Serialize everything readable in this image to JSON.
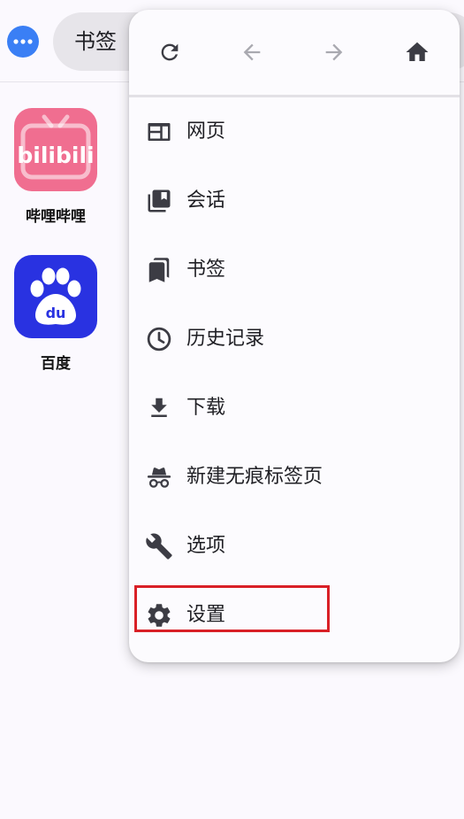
{
  "header": {
    "search_text": "书签"
  },
  "shortcuts": [
    {
      "label": "哔哩哔哩",
      "icon": "bilibili-logo-icon",
      "color": "#f06e90"
    },
    {
      "label": "百度",
      "icon": "baidu-paw-icon",
      "color": "#2932e1"
    }
  ],
  "menu": {
    "nav": [
      {
        "name": "reload",
        "icon": "reload-icon",
        "enabled": true
      },
      {
        "name": "back",
        "icon": "arrow-left-icon",
        "enabled": false
      },
      {
        "name": "forward",
        "icon": "arrow-right-icon",
        "enabled": false
      },
      {
        "name": "home",
        "icon": "home-icon",
        "enabled": true
      }
    ],
    "items": [
      {
        "label": "网页",
        "icon": "webpage-icon"
      },
      {
        "label": "会话",
        "icon": "sessions-icon"
      },
      {
        "label": "书签",
        "icon": "bookmarks-icon"
      },
      {
        "label": "历史记录",
        "icon": "history-clock-icon"
      },
      {
        "label": "下载",
        "icon": "download-icon"
      },
      {
        "label": "新建无痕标签页",
        "icon": "incognito-icon"
      },
      {
        "label": "选项",
        "icon": "wrench-icon"
      },
      {
        "label": "设置",
        "icon": "gear-icon"
      }
    ],
    "highlighted_item": "设置"
  },
  "colors": {
    "accent": "#3a7ff5",
    "highlight": "#d92027",
    "icon": "#3c3c44",
    "disabled_icon": "#a9a9b0"
  }
}
